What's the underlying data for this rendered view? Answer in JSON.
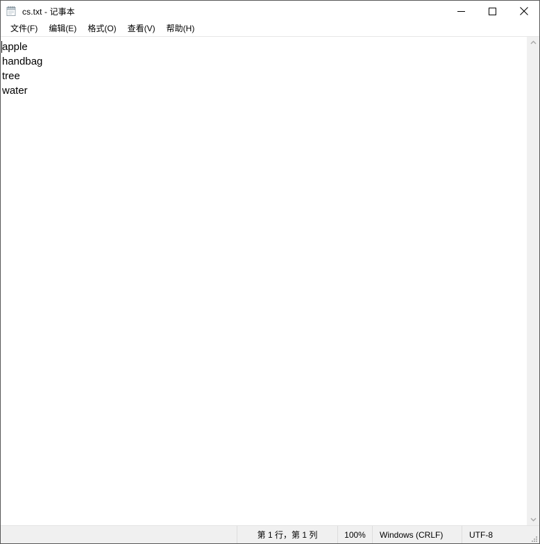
{
  "window": {
    "title": "cs.txt - 记事本",
    "icon": "notepad-icon"
  },
  "window_controls": {
    "minimize_label": "最小化",
    "maximize_label": "最大化",
    "close_label": "关闭"
  },
  "menubar": {
    "items": [
      {
        "label": "文件(F)",
        "name": "menu-file"
      },
      {
        "label": "编辑(E)",
        "name": "menu-edit"
      },
      {
        "label": "格式(O)",
        "name": "menu-format"
      },
      {
        "label": "查看(V)",
        "name": "menu-view"
      },
      {
        "label": "帮助(H)",
        "name": "menu-help"
      }
    ]
  },
  "editor": {
    "content": "apple\nhandbag\ntree\nwater",
    "lines": [
      "apple",
      "handbag",
      "tree",
      "water"
    ]
  },
  "scrollbar": {
    "up_arrow": "chevron-up-icon",
    "down_arrow": "chevron-down-icon"
  },
  "statusbar": {
    "position": "第 1 行，第 1 列",
    "zoom": "100%",
    "line_ending": "Windows (CRLF)",
    "encoding": "UTF-8"
  },
  "colors": {
    "window_bg": "#ffffff",
    "statusbar_bg": "#f0f0f0",
    "scrollbar_bg": "#f0f0f0",
    "border": "#565656",
    "text": "#000000"
  }
}
